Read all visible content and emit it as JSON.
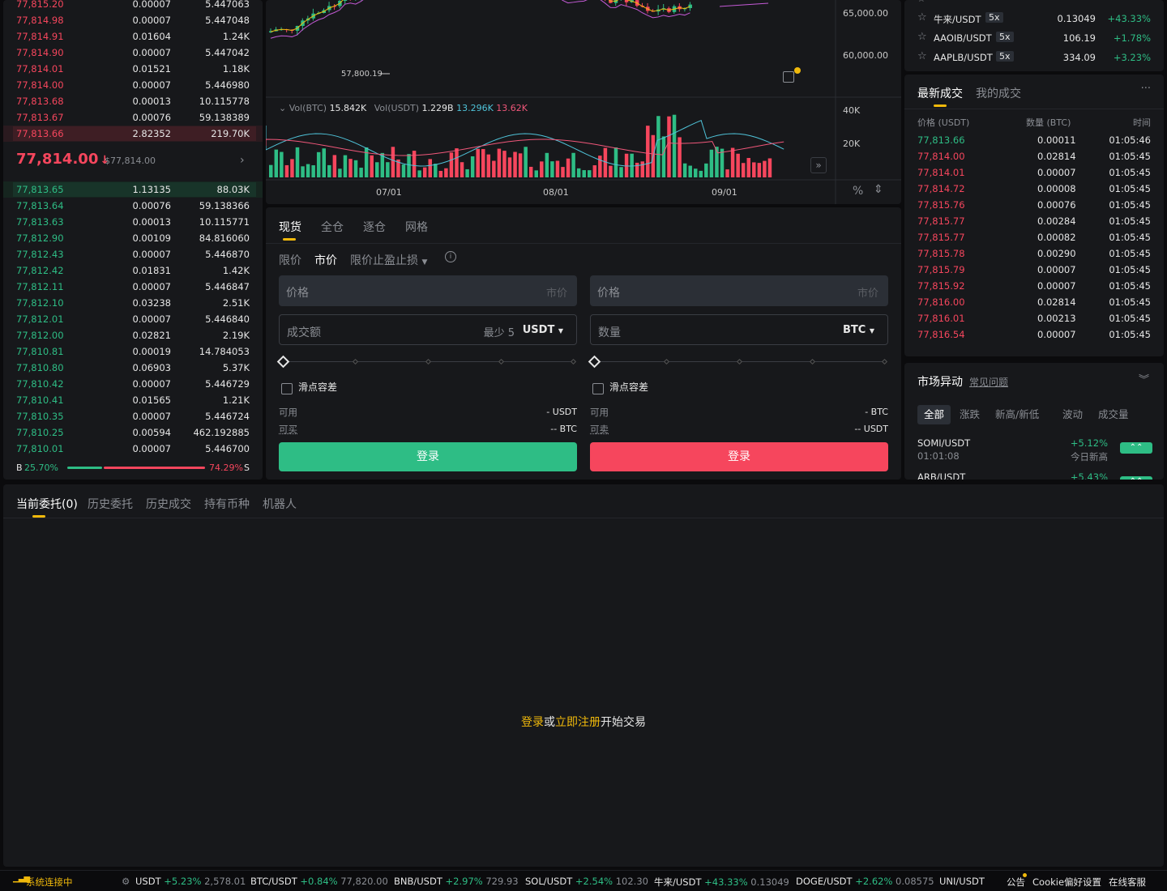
{
  "orderbook": {
    "asks": [
      {
        "price": "77,815.20",
        "qty": "0.00007",
        "total": "5.447063"
      },
      {
        "price": "77,814.98",
        "qty": "0.00007",
        "total": "5.447048"
      },
      {
        "price": "77,814.91",
        "qty": "0.01604",
        "total": "1.24K"
      },
      {
        "price": "77,814.90",
        "qty": "0.00007",
        "total": "5.447042"
      },
      {
        "price": "77,814.01",
        "qty": "0.01521",
        "total": "1.18K"
      },
      {
        "price": "77,814.00",
        "qty": "0.00007",
        "total": "5.446980"
      },
      {
        "price": "77,813.68",
        "qty": "0.00013",
        "total": "10.115778"
      },
      {
        "price": "77,813.67",
        "qty": "0.00076",
        "total": "59.138389"
      },
      {
        "price": "77,813.66",
        "qty": "2.82352",
        "total": "219.70K"
      }
    ],
    "mid_price": "77,814.00",
    "mid_arrow": "↓",
    "mid_sub": "$77,814.00",
    "bids": [
      {
        "price": "77,813.65",
        "qty": "1.13135",
        "total": "88.03K"
      },
      {
        "price": "77,813.64",
        "qty": "0.00076",
        "total": "59.138366"
      },
      {
        "price": "77,813.63",
        "qty": "0.00013",
        "total": "10.115771"
      },
      {
        "price": "77,812.90",
        "qty": "0.00109",
        "total": "84.816060"
      },
      {
        "price": "77,812.43",
        "qty": "0.00007",
        "total": "5.446870"
      },
      {
        "price": "77,812.42",
        "qty": "0.01831",
        "total": "1.42K"
      },
      {
        "price": "77,812.11",
        "qty": "0.00007",
        "total": "5.446847"
      },
      {
        "price": "77,812.10",
        "qty": "0.03238",
        "total": "2.51K"
      },
      {
        "price": "77,812.01",
        "qty": "0.00007",
        "total": "5.446840"
      },
      {
        "price": "77,812.00",
        "qty": "0.02821",
        "total": "2.19K"
      },
      {
        "price": "77,810.81",
        "qty": "0.00019",
        "total": "14.784053"
      },
      {
        "price": "77,810.80",
        "qty": "0.06903",
        "total": "5.37K"
      },
      {
        "price": "77,810.42",
        "qty": "0.00007",
        "total": "5.446729"
      },
      {
        "price": "77,810.41",
        "qty": "0.01565",
        "total": "1.21K"
      },
      {
        "price": "77,810.35",
        "qty": "0.00007",
        "total": "5.446724"
      },
      {
        "price": "77,810.25",
        "qty": "0.00594",
        "total": "462.192885"
      },
      {
        "price": "77,810.01",
        "qty": "0.00007",
        "total": "5.446700"
      }
    ],
    "ratio": {
      "buy_label": "B",
      "buy_pct": "25.70%",
      "buy_value": 25.7,
      "sell_pct": "74.29%",
      "sell_label": "S"
    }
  },
  "chart": {
    "price_ticks": [
      "65,000.00",
      "60,000.00"
    ],
    "low_marker": "57,800.19",
    "vol_label_btc": "Vol(BTC)",
    "vol_btc": "15.842K",
    "vol_label_usdt": "Vol(USDT)",
    "vol_usdt": "1.229B",
    "vol_ma1": "13.296K",
    "vol_ma2": "13.62K",
    "vol_ticks": [
      "40K",
      "20K"
    ],
    "dates": [
      "07/01",
      "08/01",
      "09/01"
    ],
    "pct_icon_text": "%"
  },
  "trade": {
    "tabs": [
      "现货",
      "全仓",
      "逐仓",
      "网格"
    ],
    "order_types": [
      "限价",
      "市价",
      "限价止盈止损"
    ],
    "buy": {
      "price_label": "价格",
      "price_right": "市价",
      "amount_label": "成交额",
      "amount_hint": "最少 5",
      "amount_unit": "USDT",
      "slippage": "滑点容差",
      "avail_label": "可用",
      "avail_value": "- USDT",
      "can_label": "可买",
      "can_value": "-- BTC",
      "button": "登录"
    },
    "sell": {
      "price_label": "价格",
      "price_right": "市价",
      "amount_label": "数量",
      "amount_unit": "BTC",
      "slippage": "滑点容差",
      "avail_label": "可用",
      "avail_value": "- BTC",
      "can_label": "可卖",
      "can_value": "-- USDT",
      "button": "登录"
    }
  },
  "watchlist": [
    {
      "name": "牛来/USDT",
      "lev": "5x",
      "price": "0.13049",
      "chg": "+43.33%"
    },
    {
      "name": "AAOIB/USDT",
      "lev": "5x",
      "price": "106.19",
      "chg": "+1.78%"
    },
    {
      "name": "AAPLB/USDT",
      "lev": "5x",
      "price": "334.09",
      "chg": "+3.23%"
    }
  ],
  "trades": {
    "tabs": [
      "最新成交",
      "我的成交"
    ],
    "more": "···",
    "headers": [
      "价格 (USDT)",
      "数量 (BTC)",
      "时间"
    ],
    "rows": [
      {
        "price": "77,813.66",
        "qty": "0.00011",
        "time": "01:05:46",
        "side": "buy"
      },
      {
        "price": "77,814.00",
        "qty": "0.02814",
        "time": "01:05:45",
        "side": "sell"
      },
      {
        "price": "77,814.01",
        "qty": "0.00007",
        "time": "01:05:45",
        "side": "sell"
      },
      {
        "price": "77,814.72",
        "qty": "0.00008",
        "time": "01:05:45",
        "side": "sell"
      },
      {
        "price": "77,815.76",
        "qty": "0.00076",
        "time": "01:05:45",
        "side": "sell"
      },
      {
        "price": "77,815.77",
        "qty": "0.00284",
        "time": "01:05:45",
        "side": "sell"
      },
      {
        "price": "77,815.77",
        "qty": "0.00082",
        "time": "01:05:45",
        "side": "sell"
      },
      {
        "price": "77,815.78",
        "qty": "0.00290",
        "time": "01:05:45",
        "side": "sell"
      },
      {
        "price": "77,815.79",
        "qty": "0.00007",
        "time": "01:05:45",
        "side": "sell"
      },
      {
        "price": "77,815.92",
        "qty": "0.00007",
        "time": "01:05:45",
        "side": "sell"
      },
      {
        "price": "77,816.00",
        "qty": "0.02814",
        "time": "01:05:45",
        "side": "sell"
      },
      {
        "price": "77,816.01",
        "qty": "0.00213",
        "time": "01:05:45",
        "side": "sell"
      },
      {
        "price": "77,816.54",
        "qty": "0.00007",
        "time": "01:05:45",
        "side": "sell"
      }
    ]
  },
  "movers": {
    "title": "市场异动",
    "faq": "常见问题",
    "filters": [
      "全部",
      "涨跌",
      "新高/新低",
      "波动",
      "成交量"
    ],
    "rows": [
      {
        "pair": "SOMI/USDT",
        "time": "01:01:08",
        "chg": "+5.12%",
        "note": "今日新高"
      },
      {
        "pair": "ARB/USDT",
        "time": "",
        "chg": "+5.43%",
        "note": ""
      }
    ]
  },
  "orders": {
    "tabs": [
      "当前委托(0)",
      "历史委托",
      "历史成交",
      "持有币种",
      "机器人"
    ],
    "empty_login": "登录",
    "empty_or": "或",
    "empty_register": "立即注册",
    "empty_suffix": "开始交易"
  },
  "footer": {
    "status": "系统连接中",
    "ticker": [
      {
        "pair": "USDT",
        "chg": "+5.23%",
        "price": "2,578.01"
      },
      {
        "pair": "BTC/USDT",
        "chg": "+0.84%",
        "price": "77,820.00"
      },
      {
        "pair": "BNB/USDT",
        "chg": "+2.97%",
        "price": "729.93"
      },
      {
        "pair": "SOL/USDT",
        "chg": "+2.54%",
        "price": "102.30"
      },
      {
        "pair": "牛来/USDT",
        "chg": "+43.33%",
        "price": "0.13049"
      },
      {
        "pair": "DOGE/USDT",
        "chg": "+2.62%",
        "price": "0.08575"
      },
      {
        "pair": "UNI/USDT",
        "chg": "",
        "price": ""
      }
    ],
    "announce": "公告",
    "cookie": "Cookie偏好设置",
    "support": "在线客服"
  },
  "colors": {
    "up": "#2ebd85",
    "down": "#f6465d",
    "accent": "#f0b90b",
    "panel": "#17181b"
  }
}
